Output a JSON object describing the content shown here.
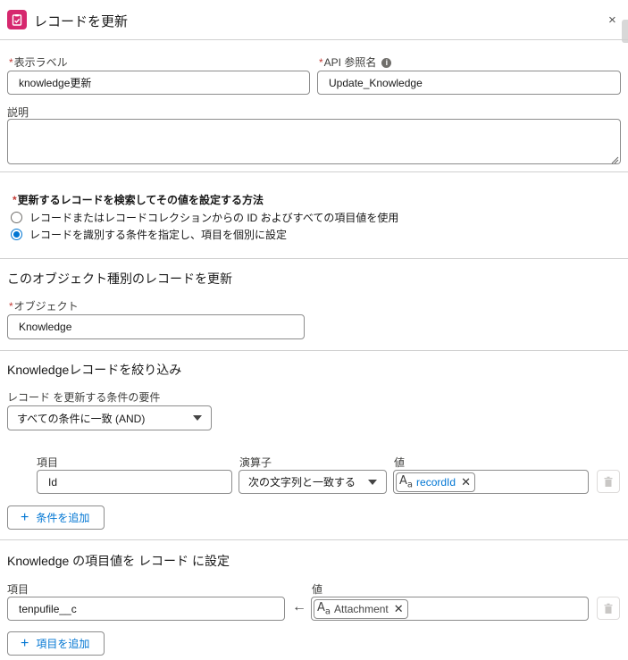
{
  "header": {
    "title": "レコードを更新",
    "close": "×"
  },
  "fields": {
    "display_label": {
      "label": "表示ラベル",
      "value": "knowledge更新"
    },
    "api_name": {
      "label": "API 参照名",
      "value": "Update_Knowledge"
    },
    "description": {
      "label": "説明",
      "value": ""
    }
  },
  "method": {
    "label": "更新するレコードを検索してその値を設定する方法",
    "options": [
      {
        "label": "レコードまたはレコードコレクションからの ID およびすべての項目値を使用",
        "selected": false
      },
      {
        "label": "レコードを識別する条件を指定し、項目を個別に設定",
        "selected": true
      }
    ]
  },
  "object_section": {
    "title": "このオブジェクト種別のレコードを更新",
    "object_label": "オブジェクト",
    "object_value": "Knowledge"
  },
  "filter_section": {
    "title": "Knowledgeレコードを絞り込み",
    "requirement_label": "レコード を更新する条件の要件",
    "requirement_value": "すべての条件に一致 (AND)",
    "col_field": "項目",
    "col_operator": "演算子",
    "col_value": "値",
    "row": {
      "field": "Id",
      "operator": "次の文字列と一致する",
      "value": "recordId"
    },
    "add_condition": "条件を追加"
  },
  "set_section": {
    "title": "Knowledge の項目値を レコード に設定",
    "col_field": "項目",
    "col_value": "値",
    "row": {
      "field": "tenpufile__c",
      "value": "Attachment"
    },
    "add_field": "項目を追加"
  },
  "colors": {
    "accent": "#0176d3",
    "icon_bg": "#d6286e",
    "required": "#c23934"
  },
  "icons": {
    "header": "clipboard-icon",
    "info": "info-icon",
    "close": "close-icon",
    "trash": "trash-icon",
    "resource": "text-resource-icon",
    "arrow": "left-arrow-icon"
  }
}
